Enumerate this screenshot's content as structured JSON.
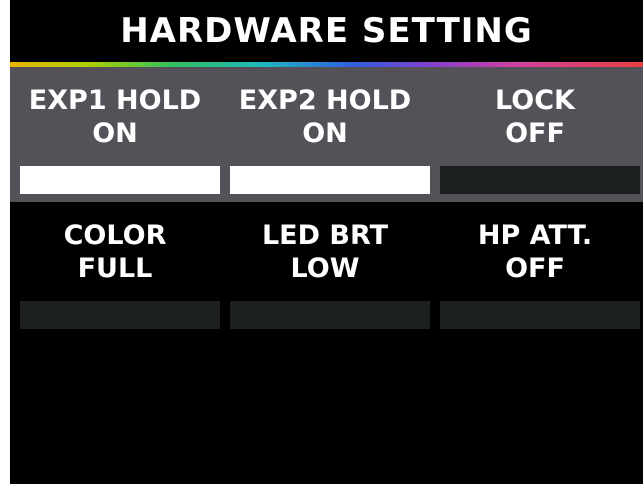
{
  "title": "HARDWARE SETTING",
  "colors": {
    "screen_background": "#000000",
    "selected_row_background": "#555158",
    "indicator_on": "#ffffff",
    "indicator_off": "#1c201e",
    "text": "#ffffff"
  },
  "rows": [
    {
      "selected": true,
      "items": [
        {
          "label": "EXP1 HOLD",
          "value": "ON",
          "indicator_on": true
        },
        {
          "label": "EXP2 HOLD",
          "value": "ON",
          "indicator_on": true
        },
        {
          "label": "LOCK",
          "value": "OFF",
          "indicator_on": false
        }
      ]
    },
    {
      "selected": false,
      "items": [
        {
          "label": "COLOR",
          "value": "FULL",
          "indicator_on": false
        },
        {
          "label": "LED BRT",
          "value": "LOW",
          "indicator_on": false
        },
        {
          "label": "HP ATT.",
          "value": "OFF",
          "indicator_on": false
        }
      ]
    }
  ]
}
